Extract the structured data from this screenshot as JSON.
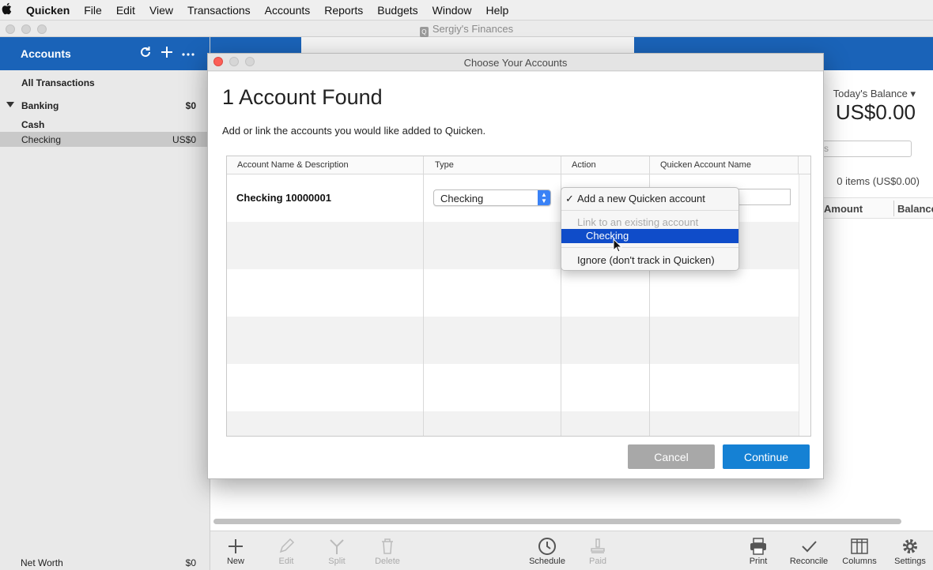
{
  "menubar": {
    "items": [
      "Quicken",
      "File",
      "Edit",
      "View",
      "Transactions",
      "Accounts",
      "Reports",
      "Budgets",
      "Window",
      "Help"
    ]
  },
  "window": {
    "title": "Sergiy's Finances"
  },
  "sidebar": {
    "title": "Accounts",
    "all_transactions": "All Transactions",
    "group": {
      "label": "Banking",
      "value": "$0"
    },
    "items": [
      {
        "label": "Cash",
        "value": ""
      },
      {
        "label": "Checking",
        "value": "US$0"
      }
    ],
    "net_worth": {
      "label": "Net Worth",
      "value": "$0"
    }
  },
  "main": {
    "balance_label": "Today's Balance ▾",
    "balance_value": "US$0.00",
    "search_placeholder": "s",
    "items_count": "0 items (US$0.00)",
    "columns": [
      "Amount",
      "Balance"
    ]
  },
  "toolbar": {
    "left": [
      {
        "label": "New",
        "icon": "plus-icon",
        "enabled": true
      },
      {
        "label": "Edit",
        "icon": "pencil-icon",
        "enabled": false
      },
      {
        "label": "Split",
        "icon": "split-icon",
        "enabled": false
      },
      {
        "label": "Delete",
        "icon": "trash-icon",
        "enabled": false
      }
    ],
    "center": [
      {
        "label": "Schedule",
        "icon": "clock-icon",
        "enabled": true
      },
      {
        "label": "Paid",
        "icon": "stamp-icon",
        "enabled": false
      }
    ],
    "right": [
      {
        "label": "Print",
        "icon": "printer-icon",
        "enabled": true
      },
      {
        "label": "Reconcile",
        "icon": "checkmark-icon",
        "enabled": true
      },
      {
        "label": "Columns",
        "icon": "columns-icon",
        "enabled": true
      },
      {
        "label": "Settings",
        "icon": "gear-icon",
        "enabled": true
      }
    ]
  },
  "dialog": {
    "title": "Choose Your Accounts",
    "heading": "1 Account Found",
    "instructions": "Add or link the accounts you would like added to Quicken.",
    "columns": [
      "Account Name & Description",
      "Type",
      "Action",
      "Quicken Account Name"
    ],
    "row": {
      "account_name": "Checking 10000001",
      "type": "Checking",
      "quicken_name": ""
    },
    "action_menu": {
      "checked_option": "Add a new Quicken account",
      "section_label": "Link to an existing account",
      "highlighted_option": "Checking",
      "ignore_option": "Ignore (don't track in Quicken)"
    },
    "buttons": {
      "cancel": "Cancel",
      "continue": "Continue"
    }
  },
  "colors": {
    "brand_blue": "#1a63b8",
    "continue_blue": "#1581d4",
    "menu_highlight": "#0f4cc9",
    "close_red": "#fc5f57"
  }
}
